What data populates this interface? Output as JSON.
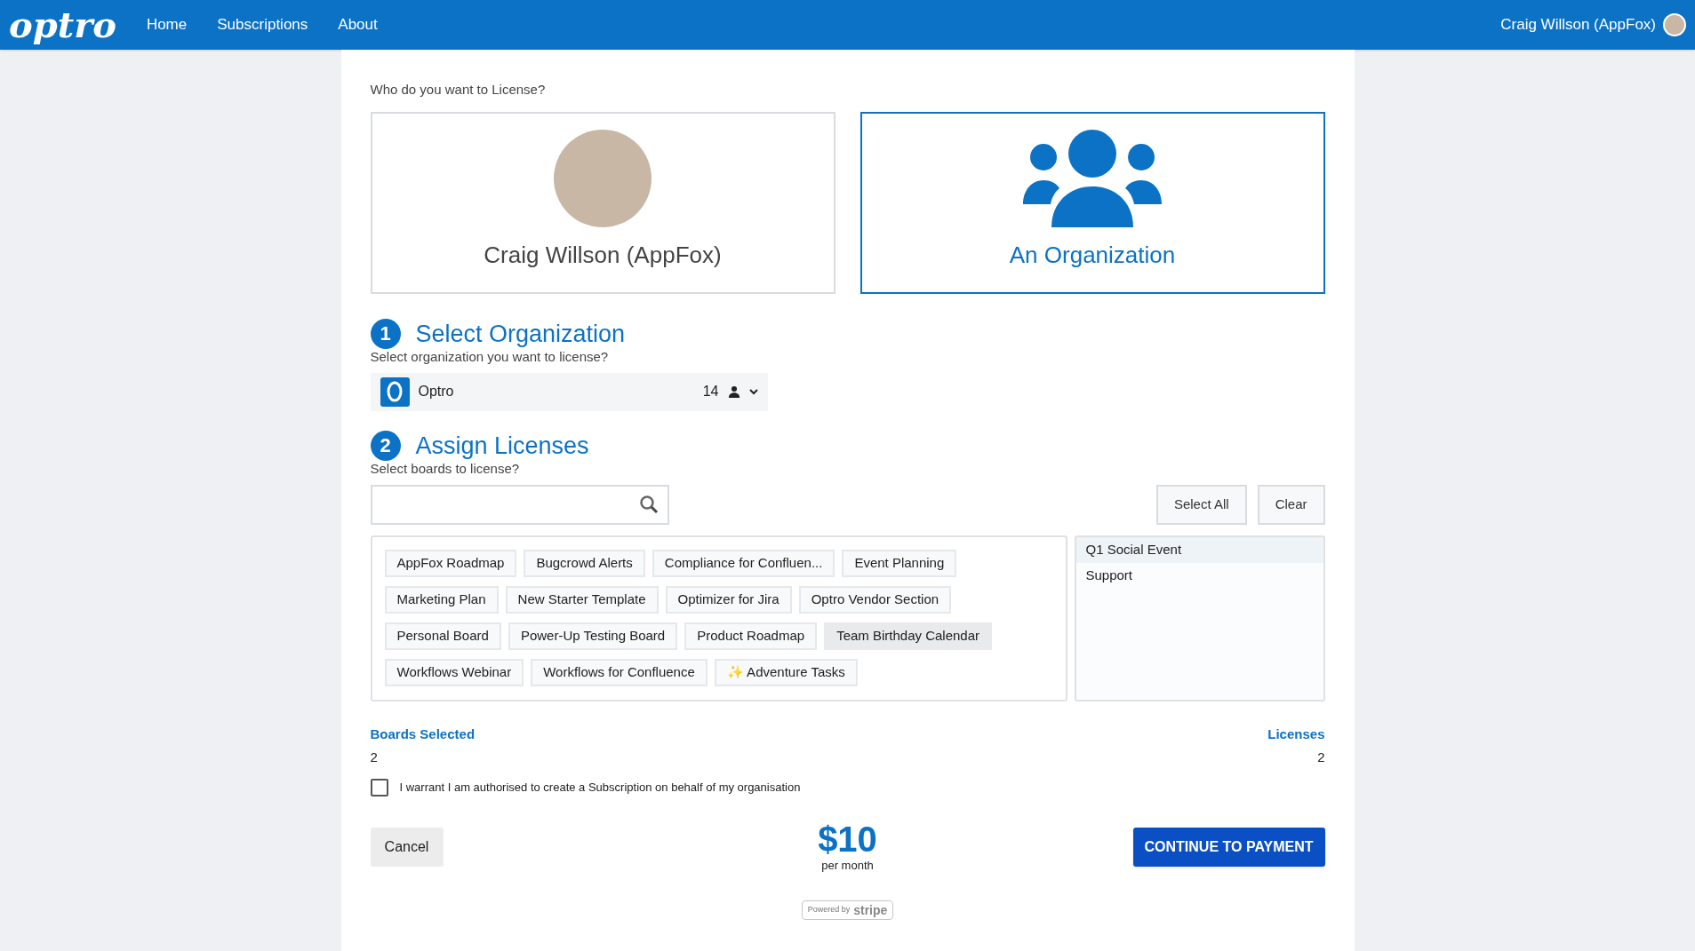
{
  "nav": {
    "logo": "optro",
    "links": [
      "Home",
      "Subscriptions",
      "About"
    ],
    "user": "Craig Willson (AppFox)"
  },
  "license_target": {
    "prompt": "Who do you want to License?",
    "options": [
      {
        "kind": "person",
        "label": "Craig Willson (AppFox)",
        "selected": false
      },
      {
        "kind": "organization",
        "label": "An Organization",
        "selected": true
      }
    ]
  },
  "step_1": {
    "number": "1",
    "title": "Select Organization",
    "subtitle": "Select organization you want to license?",
    "organization": {
      "name": "Optro",
      "members": "14"
    }
  },
  "step_2": {
    "number": "2",
    "title": "Assign Licenses",
    "subtitle": "Select boards to license?",
    "buttons": [
      "Select All",
      "Clear"
    ],
    "boards": [
      {
        "label": "AppFox Roadmap",
        "hovered": false
      },
      {
        "label": "Bugcrowd Alerts",
        "hovered": false
      },
      {
        "label": "Compliance for Confluen...",
        "hovered": false
      },
      {
        "label": "Event Planning",
        "hovered": false
      },
      {
        "label": "Marketing Plan",
        "hovered": false
      },
      {
        "label": "New Starter Template",
        "hovered": false
      },
      {
        "label": "Optimizer for Jira",
        "hovered": false
      },
      {
        "label": "Optro Vendor Section",
        "hovered": false
      },
      {
        "label": "Personal Board",
        "hovered": false
      },
      {
        "label": "Power-Up Testing Board",
        "hovered": false
      },
      {
        "label": "Product Roadmap",
        "hovered": false
      },
      {
        "label": "Team Birthday Calendar",
        "hovered": true
      },
      {
        "label": "Workflows Webinar",
        "hovered": false
      },
      {
        "label": "Workflows for Confluence",
        "hovered": false
      },
      {
        "label": "✨ Adventure Tasks",
        "hovered": false
      }
    ],
    "selected_boards": [
      {
        "label": "Q1 Social Event",
        "hovered": true
      },
      {
        "label": "Support",
        "hovered": false
      }
    ]
  },
  "summary": {
    "boards_selected_label": "Boards Selected",
    "boards_selected": "2",
    "licenses_label": "Licenses",
    "licenses": "2"
  },
  "warrant": {
    "label": "I warrant I am authorised to create a Subscription on behalf of my organisation",
    "checked": false
  },
  "footer": {
    "cancel": "Cancel",
    "price": "$10",
    "period": "per month",
    "continue": "CONTINUE TO PAYMENT",
    "badge_prefix": "Powered by",
    "badge_brand": "stripe"
  }
}
